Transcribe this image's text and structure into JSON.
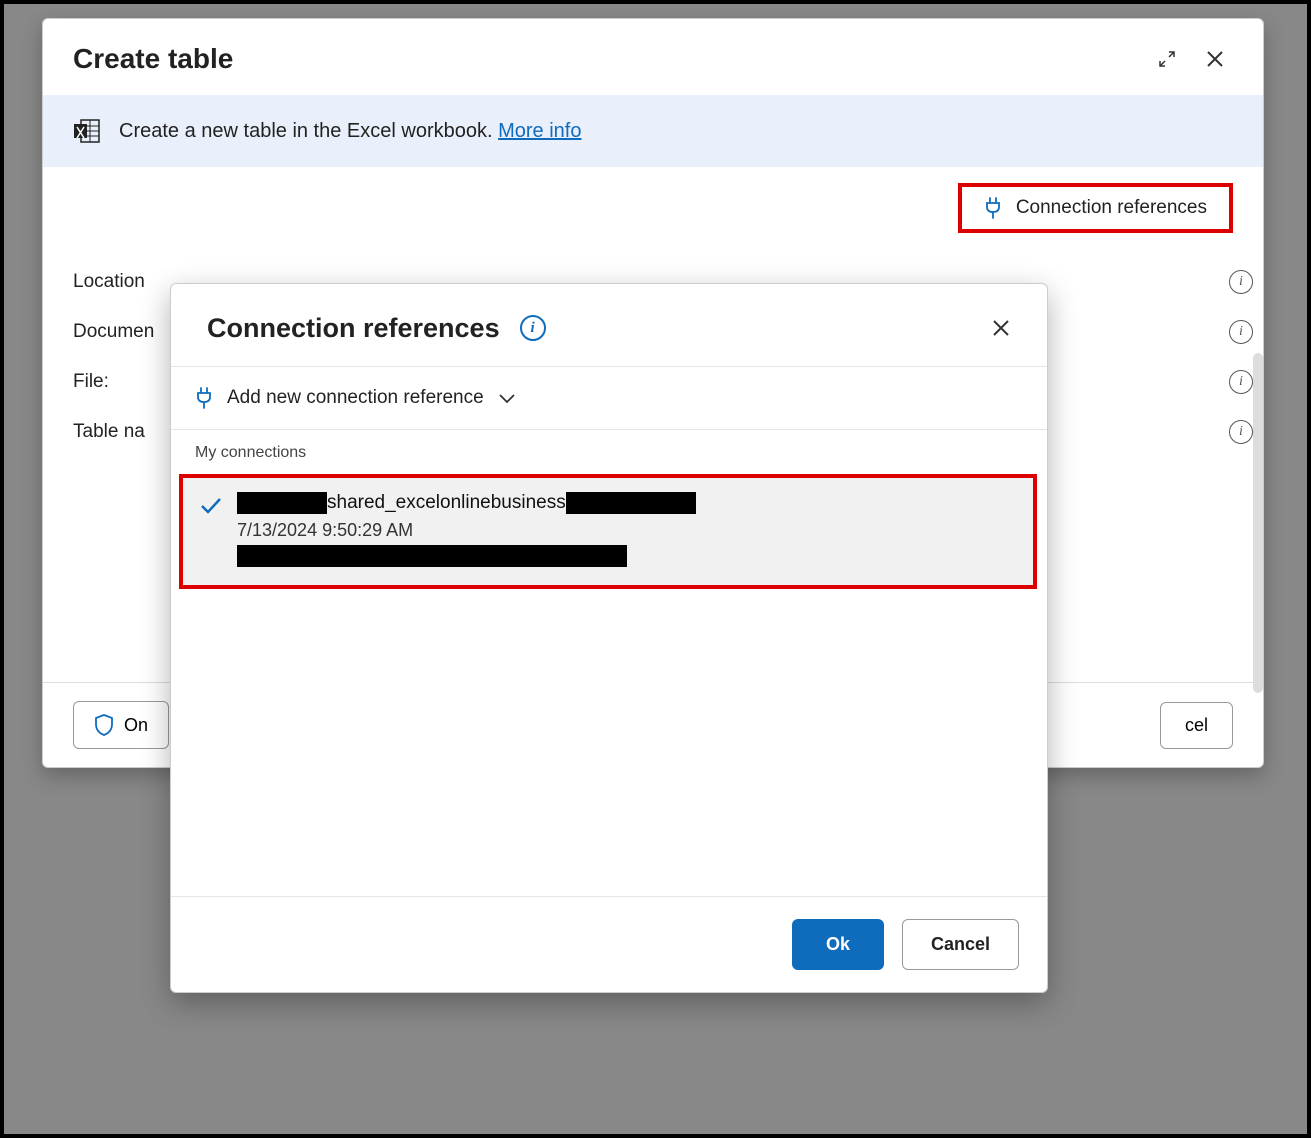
{
  "main": {
    "title": "Create table",
    "banner_text": "Create a new table in the Excel workbook. ",
    "more_info": "More info",
    "conn_ref_label": "Connection references",
    "fields": {
      "location": "Location",
      "document": "Documen",
      "file": "File:",
      "table_name": "Table na"
    },
    "footer": {
      "on_label": "On",
      "cancel_suffix": "cel"
    }
  },
  "popup": {
    "title": "Connection references",
    "add_label": "Add new connection reference",
    "section_label": "My connections",
    "connection": {
      "middle_text": "shared_excelonlinebusiness",
      "timestamp": "7/13/2024 9:50:29 AM"
    },
    "ok": "Ok",
    "cancel": "Cancel"
  }
}
